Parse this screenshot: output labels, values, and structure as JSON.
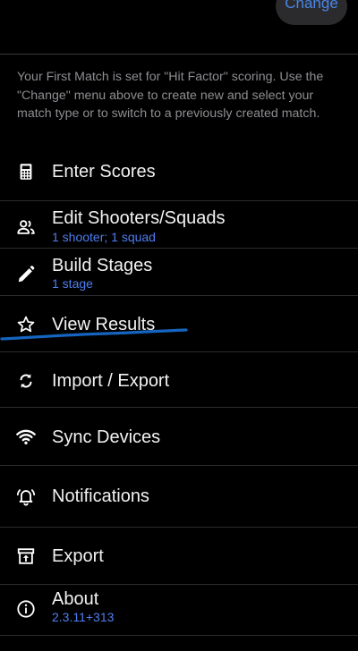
{
  "header": {
    "change_label": "Change"
  },
  "info": {
    "text": "Your First Match is set for \"Hit Factor\" scoring. Use the \"Change\" menu above to create new and select your match type or to switch to a previously created match."
  },
  "menu": {
    "items": [
      {
        "label": "Enter Scores",
        "icon": "calculator-icon"
      },
      {
        "label": "Edit Shooters/Squads",
        "subtitle": "1 shooter; 1 squad",
        "icon": "people-icon"
      },
      {
        "label": "Build Stages",
        "subtitle": "1 stage",
        "icon": "pencil-icon"
      },
      {
        "label": "View Results",
        "icon": "star-icon"
      },
      {
        "label": "Import / Export",
        "icon": "sync-arrows-icon"
      },
      {
        "label": "Sync Devices",
        "icon": "wifi-icon"
      },
      {
        "label": "Notifications",
        "icon": "bell-icon"
      },
      {
        "label": "Export",
        "icon": "archive-upload-icon"
      },
      {
        "label": "About",
        "subtitle": "2.3.11+313",
        "icon": "info-icon"
      }
    ]
  },
  "colors": {
    "background": "#000000",
    "accent": "#4f7ef0",
    "annotation": "#1565c0"
  }
}
